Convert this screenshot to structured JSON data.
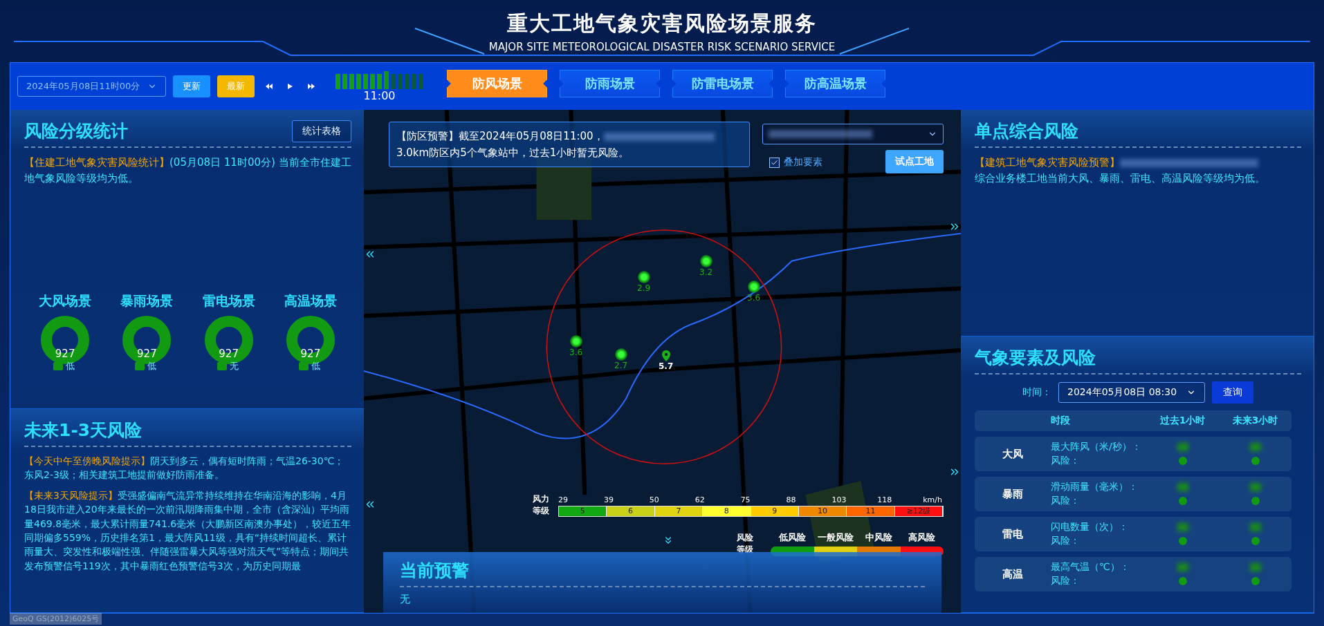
{
  "header": {
    "title": "重大工地气象灾害风险场景服务",
    "subtitle": "MAJOR SITE METEOROLOGICAL DISASTER RISK SCENARIO SERVICE"
  },
  "toolbar": {
    "datetime": "2024年05月08日11时00分",
    "buttons": [
      {
        "label": "更新",
        "kind": "primary"
      },
      {
        "label": "最新",
        "kind": "warning"
      }
    ],
    "timeline": {
      "level": 0.615,
      "label": "11:00"
    },
    "tabs": [
      {
        "label": "防风场景",
        "selected": true
      },
      {
        "label": "防雨场景",
        "selected": false
      },
      {
        "label": "防雷电场景",
        "selected": false
      },
      {
        "label": "防高温场景",
        "selected": false
      }
    ]
  },
  "risk_stats": {
    "title": "风险分级统计",
    "button": "统计表格",
    "tag": "【住建工地气象灾害风险统计】",
    "text": "(05月08日 11时00分) 当前全市住建工地气象风险等级均为低。",
    "scenes": [
      {
        "title": "大风场景",
        "count": "927",
        "legend": "低",
        "color": "#129a12"
      },
      {
        "title": "暴雨场景",
        "count": "927",
        "legend": "低",
        "color": "#129a12"
      },
      {
        "title": "雷电场景",
        "count": "927",
        "legend": "无",
        "color": "#129a12"
      },
      {
        "title": "高温场景",
        "count": "927",
        "legend": "低",
        "color": "#129a12"
      }
    ]
  },
  "future_risk": {
    "title": "未来1-3天风险",
    "notes": [
      {
        "tag": "【今天中午至傍晚风险提示】",
        "text": "阴天到多云，偶有短时阵雨；气温26-30℃；东风2-3级；相关建筑工地提前做好防雨准备。"
      },
      {
        "tag": "【未来3天风险提示】",
        "text": "受强盛偏南气流异常持续维持在华南沿海的影响，4月18日我市进入20年来最长的一次前汛期降雨集中期，全市（含深汕）平均雨量469.8毫米，最大累计雨量741.6毫米（大鹏新区南澳办事处），较近五年同期偏多559%，历史排名第1，最大阵风11级，具有“持续时间超长、累计雨量大、突发性和极端性强、伴随强雷暴大风等强对流天气”等特点；期间共发布预警信号119次，其中暴雨红色预警信号3次，为历史同期最"
      }
    ]
  },
  "map": {
    "alert": {
      "tag": "【防区预警】",
      "text": "截至2024年05月08日11:00，",
      "text_2": "3.0km防区内5个气象站中，过去1小时暂无风险。"
    },
    "overlay": {
      "label": "叠加要素",
      "checked": true
    },
    "site_button": "试点工地",
    "stations": [
      {
        "value": "3.2",
        "kind": "station"
      },
      {
        "value": "2.9",
        "kind": "station"
      },
      {
        "value": "3.6",
        "kind": "station"
      },
      {
        "value": "3.6",
        "kind": "station"
      },
      {
        "value": "2.7",
        "kind": "station"
      },
      {
        "value": "5.7",
        "kind": "site"
      }
    ],
    "wind_legend": {
      "label": "风力等级",
      "ticks": [
        "29",
        "39",
        "50",
        "62",
        "75",
        "88",
        "103",
        "118"
      ],
      "unit": "km/h",
      "levels": [
        {
          "label": "5",
          "color": "#12a812"
        },
        {
          "label": "6",
          "color": "#c8d018"
        },
        {
          "label": "7",
          "color": "#e0d410"
        },
        {
          "label": "8",
          "color": "#ffff30"
        },
        {
          "label": "9",
          "color": "#ffcc00"
        },
        {
          "label": "10",
          "color": "#ee8800"
        },
        {
          "label": "11",
          "color": "#ff6600"
        },
        {
          "label": "≥12级",
          "color": "#ff1010"
        }
      ]
    },
    "risk_legend": {
      "label": "风险等级",
      "levels": [
        {
          "label": "低风险",
          "color": "#109e10"
        },
        {
          "label": "一般风险",
          "color": "#e0d010"
        },
        {
          "label": "中风险",
          "color": "#e57a00"
        },
        {
          "label": "高风险",
          "color": "#ff1010"
        }
      ]
    },
    "current_alert": {
      "title": "当前预警",
      "text": "无"
    }
  },
  "single_point": {
    "title": "单点综合风险",
    "tag": "【建筑工地气象灾害风险预警】",
    "text": "综合业务楼工地当前大风、暴雨、雷电、高温风险等级均为低。"
  },
  "elements": {
    "title": "气象要素及风险",
    "time_label": "时间：",
    "time_value": "2024年05月08日 08:30",
    "query": "查询",
    "columns": [
      "时段",
      "过去1小时",
      "未来3小时"
    ],
    "rows": [
      {
        "name": "大风",
        "metric": "最大阵风（米/秒）：",
        "risk_label": "风险：",
        "risks": [
          {
            "color": "#129a12"
          },
          {
            "color": "#129a12"
          }
        ]
      },
      {
        "name": "暴雨",
        "metric": "滑动雨量（毫米）：",
        "risk_label": "风险：",
        "risks": [
          {
            "color": "#129a12"
          },
          {
            "color": "#129a12"
          }
        ]
      },
      {
        "name": "雷电",
        "metric": "闪电数量（次）：",
        "risk_label": "风险：",
        "risks": [
          {
            "color": "#129a12"
          },
          {
            "color": "#129a12"
          }
        ]
      },
      {
        "name": "高温",
        "metric": "最高气温（℃）：",
        "risk_label": "风险：",
        "risks": [
          {
            "color": "#129a12"
          },
          {
            "color": "#129a12"
          }
        ]
      }
    ]
  },
  "attribution": "GeoQ GS(2012)6025号"
}
